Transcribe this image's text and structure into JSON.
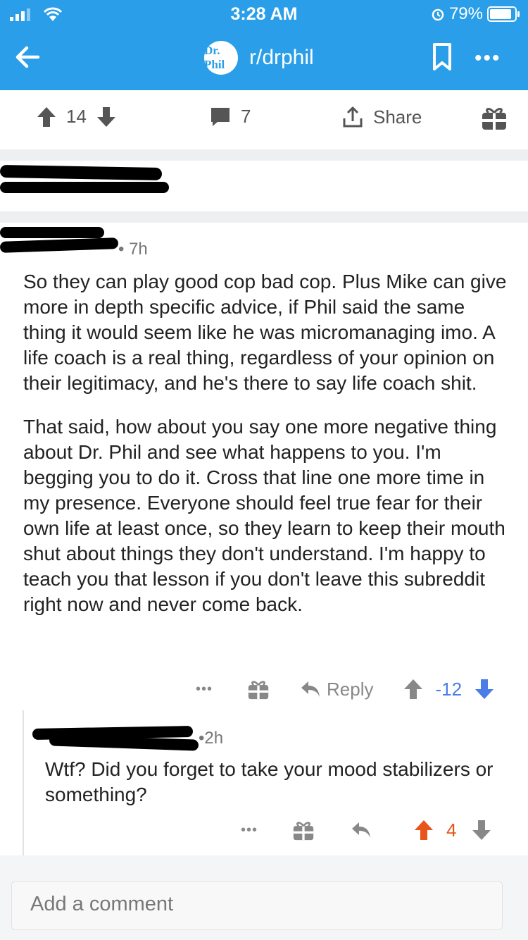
{
  "status_bar": {
    "time": "3:28 AM",
    "battery": "79%"
  },
  "nav": {
    "subreddit": "r/drphil",
    "avatar_text": "Dr. Phil"
  },
  "post_actions": {
    "upvotes": "14",
    "comments": "7",
    "share": "Share"
  },
  "comment1": {
    "time": "7h",
    "paragraph1": "So they can play good cop bad cop. Plus Mike can give more in depth specific advice, if Phil said the same thing it would seem like he was micromanaging imo. A life coach is a real thing, regardless of your opinion on their legitimacy, and he's there to say life coach shit.",
    "paragraph2": "That said, how about you say one more negative thing about Dr. Phil and see what happens to you. I'm begging you to do it. Cross that line one more time in my presence. Everyone should feel true fear for their own life at least once, so they learn to keep their mouth shut about things they don't understand. I'm happy to teach you that lesson if you don't leave this subreddit right now and never come back.",
    "more": "•••",
    "reply": "Reply",
    "score": "-12",
    "score_color": "#4a7de8"
  },
  "comment2": {
    "time": "2h",
    "text": "Wtf? Did you forget to take your mood stabilizers or something?",
    "more": "•••",
    "score": "4",
    "score_color": "#e8541a"
  },
  "composer": {
    "placeholder": "Add a comment"
  },
  "colors": {
    "header": "#2a9ee8"
  }
}
